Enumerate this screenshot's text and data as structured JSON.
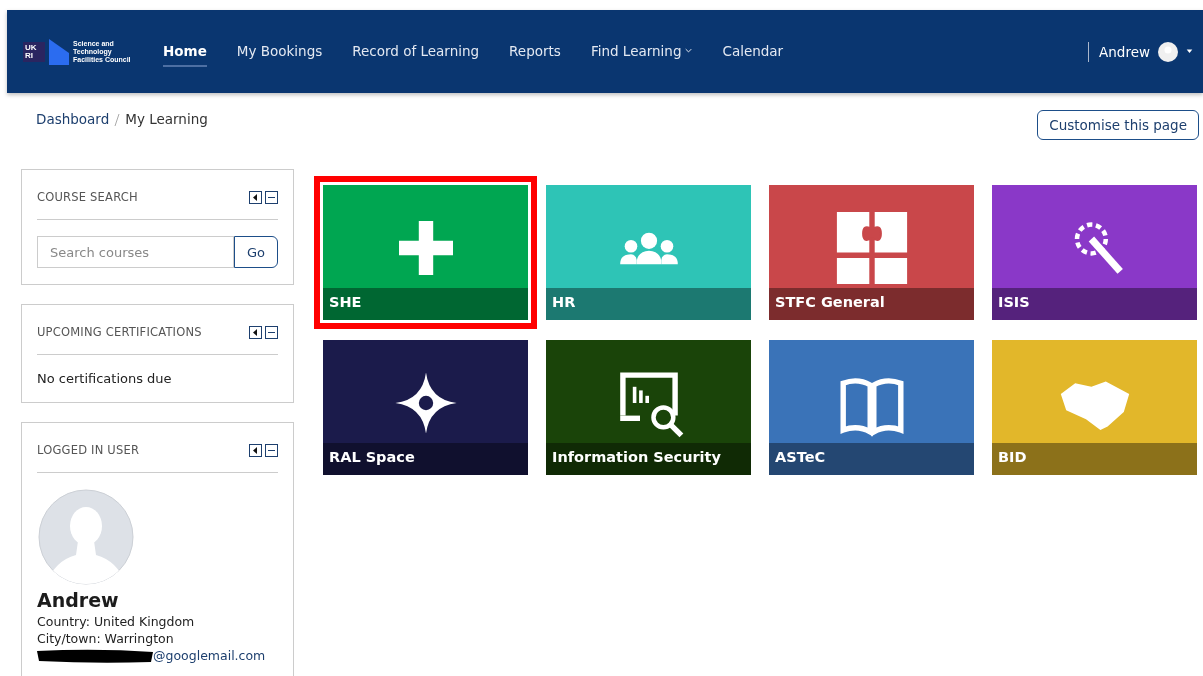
{
  "navbar": {
    "logo": {
      "mark_top": "UK",
      "mark_bottom": "RI",
      "org": "Science and Technology Facilities Council"
    },
    "items": [
      {
        "label": "Home",
        "selected": true,
        "dropdown": false
      },
      {
        "label": "My Bookings",
        "selected": false,
        "dropdown": false
      },
      {
        "label": "Record of Learning",
        "selected": false,
        "dropdown": false
      },
      {
        "label": "Reports",
        "selected": false,
        "dropdown": false
      },
      {
        "label": "Find Learning",
        "selected": false,
        "dropdown": true
      },
      {
        "label": "Calendar",
        "selected": false,
        "dropdown": false
      }
    ],
    "user": {
      "name": "Andrew"
    }
  },
  "breadcrumb": [
    "Dashboard",
    "My Learning"
  ],
  "customise_button": "Customise this page",
  "blocks": [
    {
      "kind": "search",
      "title": "COURSE SEARCH",
      "placeholder": "Search courses",
      "button": "Go"
    },
    {
      "kind": "text",
      "title": "UPCOMING CERTIFICATIONS",
      "text": "No certifications due"
    },
    {
      "kind": "user",
      "title": "LOGGED IN USER",
      "name": "Andrew",
      "lines": [
        "Country: United Kingdom",
        "City/town: Warrington"
      ],
      "email": "@googlemail.com",
      "redacted": true
    }
  ],
  "tiles": [
    {
      "label": "SHE",
      "color": "#00a651",
      "highlighted": true
    },
    {
      "label": "HR",
      "color": "#2ec4b6",
      "highlighted": false
    },
    {
      "label": "STFC General",
      "color": "#c9474a",
      "highlighted": false
    },
    {
      "label": "ISIS",
      "color": "#8a38c8",
      "highlighted": false
    },
    {
      "label": "RAL Space",
      "color": "#1b1b4b",
      "highlighted": false
    },
    {
      "label": "Information Security",
      "color": "#1a4409",
      "highlighted": false
    },
    {
      "label": "ASTeC",
      "color": "#3a73b8",
      "highlighted": false
    },
    {
      "label": "BID",
      "color": "#e2b72a",
      "highlighted": false
    }
  ]
}
